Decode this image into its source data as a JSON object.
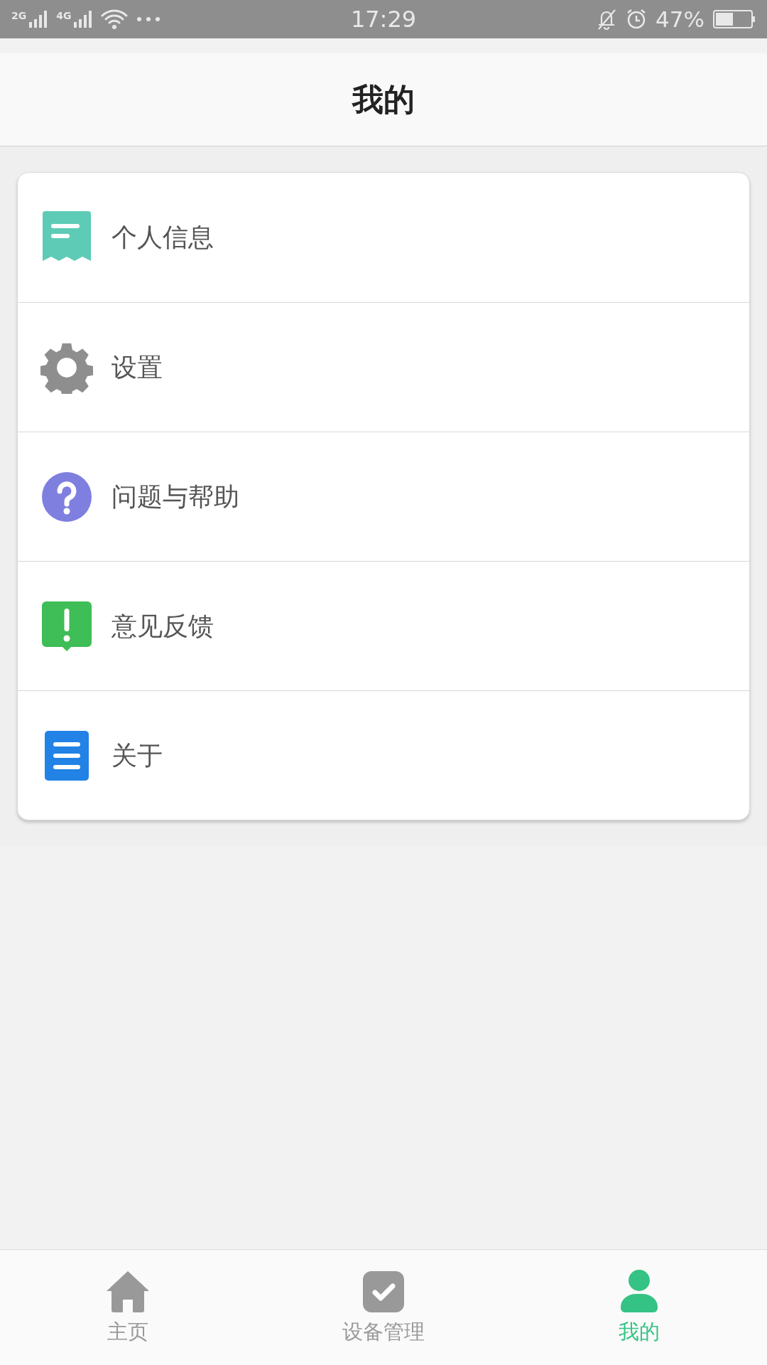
{
  "status_bar": {
    "network_1": "2G",
    "network_2": "4G",
    "time": "17:29",
    "battery": "47%"
  },
  "header": {
    "title": "我的"
  },
  "menu": [
    {
      "kind": "profile",
      "label": "个人信息"
    },
    {
      "kind": "settings",
      "label": "设置"
    },
    {
      "kind": "help",
      "label": "问题与帮助"
    },
    {
      "kind": "feedback",
      "label": "意见反馈"
    },
    {
      "kind": "about",
      "label": "关于"
    }
  ],
  "tabs": [
    {
      "kind": "home",
      "label": "主页",
      "selected": false
    },
    {
      "kind": "devices",
      "label": "设备管理",
      "selected": false
    },
    {
      "kind": "me",
      "label": "我的",
      "selected": true
    }
  ]
}
